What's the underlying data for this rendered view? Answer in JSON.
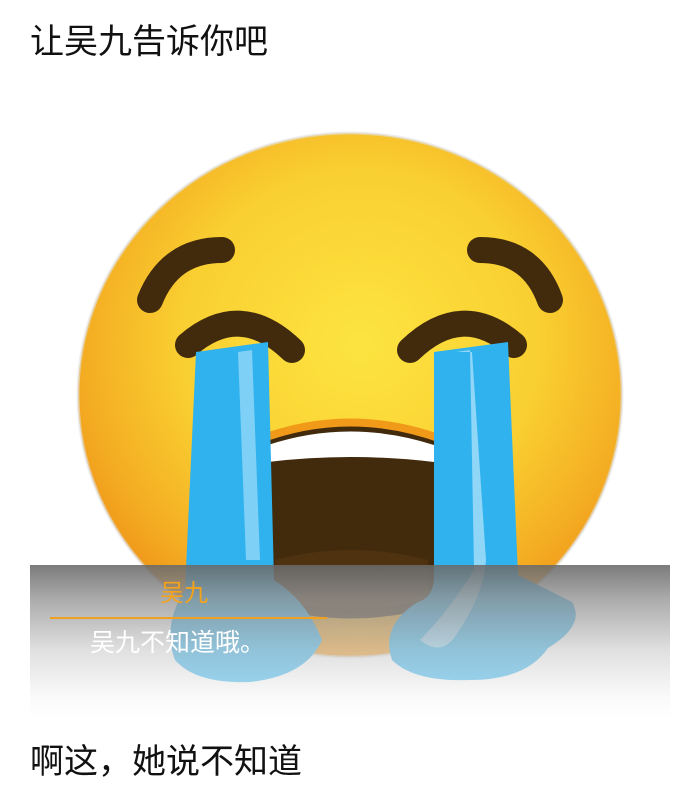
{
  "top_caption": "让吴九告诉你吧",
  "dialog": {
    "speaker": "吴九",
    "line": "吴九不知道哦。"
  },
  "bottom_caption": "啊这，她说不知道",
  "image": {
    "icon": "crying-face-icon",
    "colors": {
      "face": "#f7c62c",
      "face_edge": "#f19a19",
      "features": "#422b0d",
      "tears": "#2fb2ee",
      "dialog_name": "#f2a21b"
    }
  }
}
